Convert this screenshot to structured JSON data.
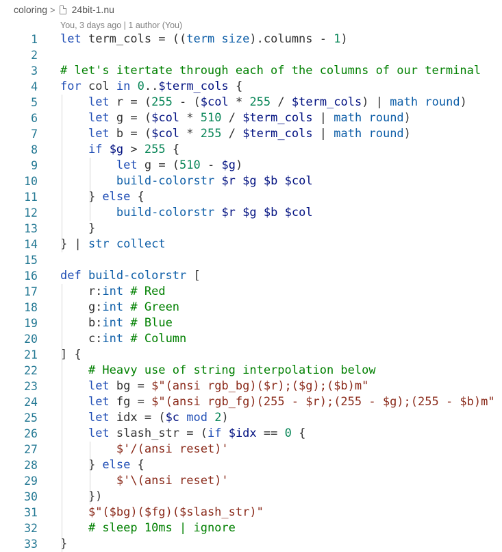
{
  "breadcrumb": {
    "folder": "coloring",
    "file": "24bit-1.nu"
  },
  "blame": "You, 3 days ago | 1 author (You)",
  "lines": [
    {
      "n": "1",
      "code": "let term_cols = ((term size).columns - 1)"
    },
    {
      "n": "2",
      "code": ""
    },
    {
      "n": "3",
      "code": "# let's itertate through each of the columns of our terminal"
    },
    {
      "n": "4",
      "code": "for col in 0..$term_cols {"
    },
    {
      "n": "5",
      "code": "    let r = (255 - ($col * 255 / $term_cols) | math round)"
    },
    {
      "n": "6",
      "code": "    let g = ($col * 510 / $term_cols | math round)"
    },
    {
      "n": "7",
      "code": "    let b = ($col * 255 / $term_cols | math round)"
    },
    {
      "n": "8",
      "code": "    if $g > 255 {"
    },
    {
      "n": "9",
      "code": "        let g = (510 - $g)"
    },
    {
      "n": "10",
      "code": "        build-colorstr $r $g $b $col"
    },
    {
      "n": "11",
      "code": "    } else {"
    },
    {
      "n": "12",
      "code": "        build-colorstr $r $g $b $col"
    },
    {
      "n": "13",
      "code": "    }"
    },
    {
      "n": "14",
      "code": "} | str collect"
    },
    {
      "n": "15",
      "code": ""
    },
    {
      "n": "16",
      "code": "def build-colorstr ["
    },
    {
      "n": "17",
      "code": "    r:int # Red"
    },
    {
      "n": "18",
      "code": "    g:int # Green"
    },
    {
      "n": "19",
      "code": "    b:int # Blue"
    },
    {
      "n": "20",
      "code": "    c:int # Column"
    },
    {
      "n": "21",
      "code": "] {"
    },
    {
      "n": "22",
      "code": "    # Heavy use of string interpolation below"
    },
    {
      "n": "23",
      "code": "    let bg = $\"(ansi rgb_bg)($r);($g);($b)m\""
    },
    {
      "n": "24",
      "code": "    let fg = $\"(ansi rgb_fg)(255 - $r);(255 - $g);(255 - $b)m\""
    },
    {
      "n": "25",
      "code": "    let idx = ($c mod 2)"
    },
    {
      "n": "26",
      "code": "    let slash_str = (if $idx == 0 {"
    },
    {
      "n": "27",
      "code": "        $'/(ansi reset)'"
    },
    {
      "n": "28",
      "code": "    } else {"
    },
    {
      "n": "29",
      "code": "        $'\\(ansi reset)'"
    },
    {
      "n": "30",
      "code": "    })"
    },
    {
      "n": "31",
      "code": "    $\"($bg)($fg)($slash_str)\""
    },
    {
      "n": "32",
      "code": "    # sleep 10ms | ignore"
    },
    {
      "n": "33",
      "code": "}"
    }
  ]
}
